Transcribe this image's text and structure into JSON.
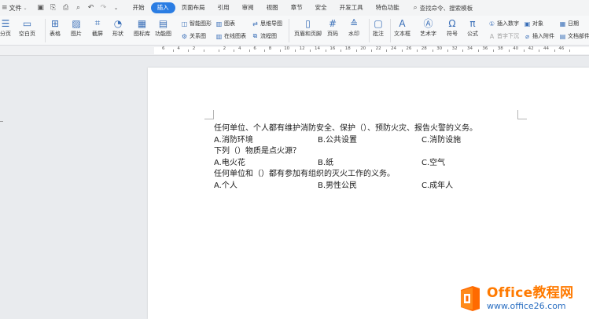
{
  "menubar": {
    "file_label": "文件",
    "tabs": [
      "开始",
      "插入",
      "页面布局",
      "引用",
      "审阅",
      "视图",
      "章节",
      "安全",
      "开发工具",
      "特色功能"
    ],
    "active_tab": "插入",
    "search_label": "查找命令、搜索模板"
  },
  "ribbon": {
    "items": {
      "fenye": "分页",
      "kongbaiye": "空白页",
      "biaoge": "表格",
      "tupian": "图片",
      "jieping": "截屏",
      "xingzhuang": "形状",
      "tubiaoku": "图标库",
      "gongnengtu": "功能图",
      "zhinengtuxing": "智能图形",
      "tubiao": "图表",
      "guanxitu": "关系图",
      "zaixiantubiao": "在线图表",
      "siweidaotu": "思维导图",
      "liuchengtu": "流程图",
      "yemeiheyejiao": "页眉和页脚",
      "yema": "页码",
      "shuiyin": "水印",
      "pizhu": "批注",
      "wenbenkuang": "文本框",
      "yishuzi": "艺术字",
      "fuhao": "符号",
      "gongshi": "公式",
      "charushuzi": "插入数字",
      "duixiang": "对象",
      "shouzixiachen": "首字下沉",
      "charufujian": "插入附件",
      "riqi": "日期",
      "wendangbujian": "文档部件"
    }
  },
  "ruler": {
    "numbers": [
      "6",
      "4",
      "2",
      "",
      "2",
      "4",
      "6",
      "8",
      "10",
      "12",
      "14",
      "16",
      "18",
      "20",
      "22",
      "24",
      "26",
      "28",
      "30",
      "32",
      "34",
      "36",
      "38",
      "40",
      "42",
      "44",
      "46"
    ]
  },
  "document": {
    "lines": [
      {
        "type": "q",
        "text": "任何单位、个人都有维护消防安全、保护（）、预防火灾、报告火警的义务。"
      },
      {
        "type": "opts",
        "a": "A.消防环境",
        "b": "B.公共设置",
        "c": "C.消防设施"
      },
      {
        "type": "q",
        "text": "下列（）物质是点火源？"
      },
      {
        "type": "opts",
        "a": "A.电火花",
        "b": "B.纸",
        "c": "C.空气"
      },
      {
        "type": "q",
        "text": "任何单位和（）都有参加有组织的灭火工作的义务。"
      },
      {
        "type": "opts",
        "a": "A.个人",
        "b": "B.男性公民",
        "c": "C.成年人"
      }
    ]
  },
  "watermark": {
    "title": "Office教程网",
    "url": "www.office26.com",
    "colors": {
      "orange": "#ff7a00",
      "blue": "#2b6fc2"
    }
  },
  "colors": {
    "accent": "#2b7de3"
  }
}
